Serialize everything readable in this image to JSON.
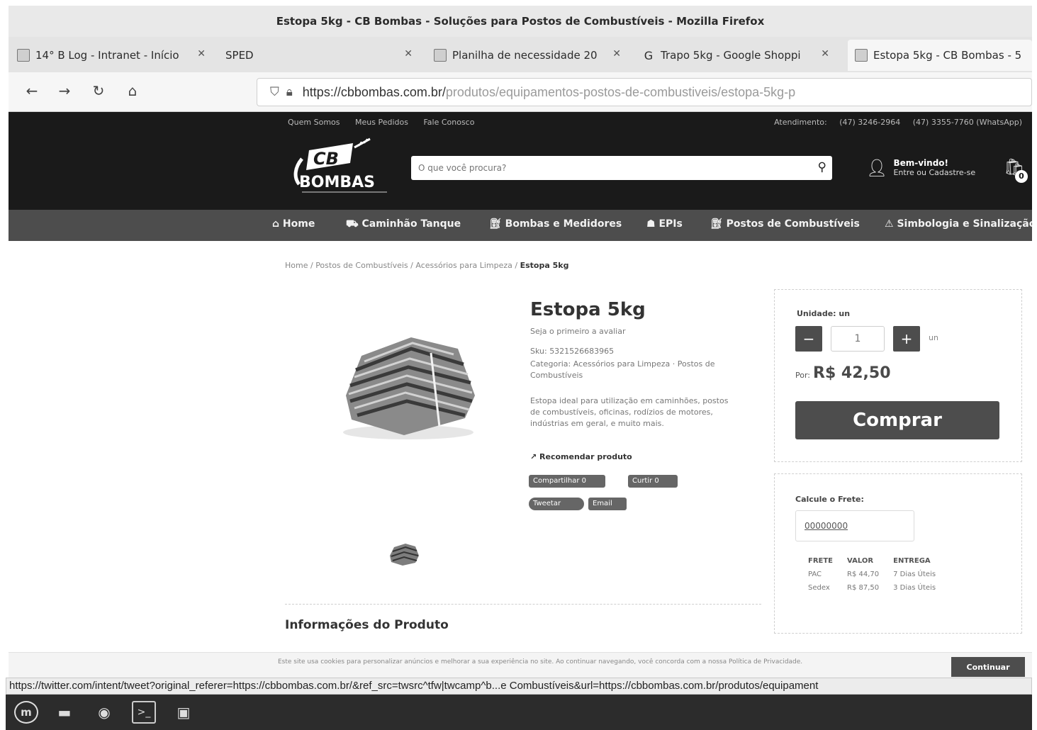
{
  "window": {
    "title": "Estopa 5kg - CB Bombas - Soluções para Postos de Combustíveis - Mozilla Firefox"
  },
  "tabs": [
    {
      "label": "14° B Log - Intranet - Início",
      "active": false
    },
    {
      "label": "SPED",
      "active": false
    },
    {
      "label": "Planilha de necessidade 20",
      "active": false
    },
    {
      "label": "Trapo 5kg - Google Shoppi",
      "active": false
    },
    {
      "label": "Estopa 5kg - CB Bombas - 5",
      "active": true
    }
  ],
  "browser": {
    "url_host": "https://cbbombas.com.br/",
    "url_path": "produtos/equipamentos-postos-de-combustiveis/estopa-5kg-p",
    "status_url": "https://twitter.com/intent/tweet?original_referer=https://cbbombas.com.br/&ref_src=twsrc^tfw|twcamp^b...e Combustíveis&url=https://cbbombas.com.br/produtos/equipament"
  },
  "site": {
    "logo_top": "CB",
    "logo_main": "BOMBAS",
    "top_links": [
      "Quem Somos",
      "Meus Pedidos",
      "Fale Conosco"
    ],
    "top_contacts": [
      "Atendimento:",
      "(47) 3246-2964",
      "(47) 3355-7760 (WhatsApp)"
    ],
    "search_placeholder": "O que você procura?",
    "account_title": "Bem-vindo!",
    "account_sub": "Entre ou Cadastre-se",
    "cart_count": "0",
    "menu": [
      "Home",
      "Caminhão Tanque",
      "Bombas e Medidores",
      "EPIs",
      "Postos de Combustíveis",
      "Simbologia e Sinalização"
    ]
  },
  "breadcrumb": {
    "items": [
      "Home",
      "Postos de Combustíveis",
      "Acessórios para Limpeza"
    ],
    "current": "Estopa 5kg"
  },
  "product": {
    "title": "Estopa 5kg",
    "review_prompt": "Seja o primeiro a avaliar",
    "sku": "Sku: 5321526683965",
    "category": "Categoria: Acessórios para Limpeza · Postos de Combustíveis",
    "description": "Estopa ideal para utilização em caminhões, postos de combustíveis, oficinas, rodízios de motores, indústrias em geral, e muito mais.",
    "recommend": "Recomendar produto",
    "share": [
      "Compartilhar 0",
      "Curtir 0",
      "Tweetar",
      "Email"
    ]
  },
  "buy": {
    "unit_label": "Unidade: un",
    "minus": "−",
    "plus": "+",
    "quantity": "1",
    "unit": "un",
    "price_prefix": "Por:",
    "price": "R$ 42,50",
    "buy_label": "Comprar"
  },
  "freight": {
    "label": "Calcule o Frete:",
    "cep": "00000000",
    "columns": [
      "FRETE",
      "VALOR",
      "ENTREGA"
    ],
    "rows": [
      [
        "PAC",
        "R$ 44,70",
        "7 Dias Úteis"
      ],
      [
        "Sedex",
        "R$ 87,50",
        "3 Dias Úteis"
      ]
    ]
  },
  "info": {
    "title": "Informações do Produto"
  },
  "cookie": {
    "text": "Este site usa cookies para personalizar anúncios e melhorar a sua experiência no site. Ao continuar navegando, você concorda com a nossa Política de Privacidade.",
    "button": "Continuar"
  },
  "colors": {
    "header_bg": "#1a1a1a",
    "menu_bg": "#4d4d4d",
    "button_bg": "#4d4d4d"
  }
}
